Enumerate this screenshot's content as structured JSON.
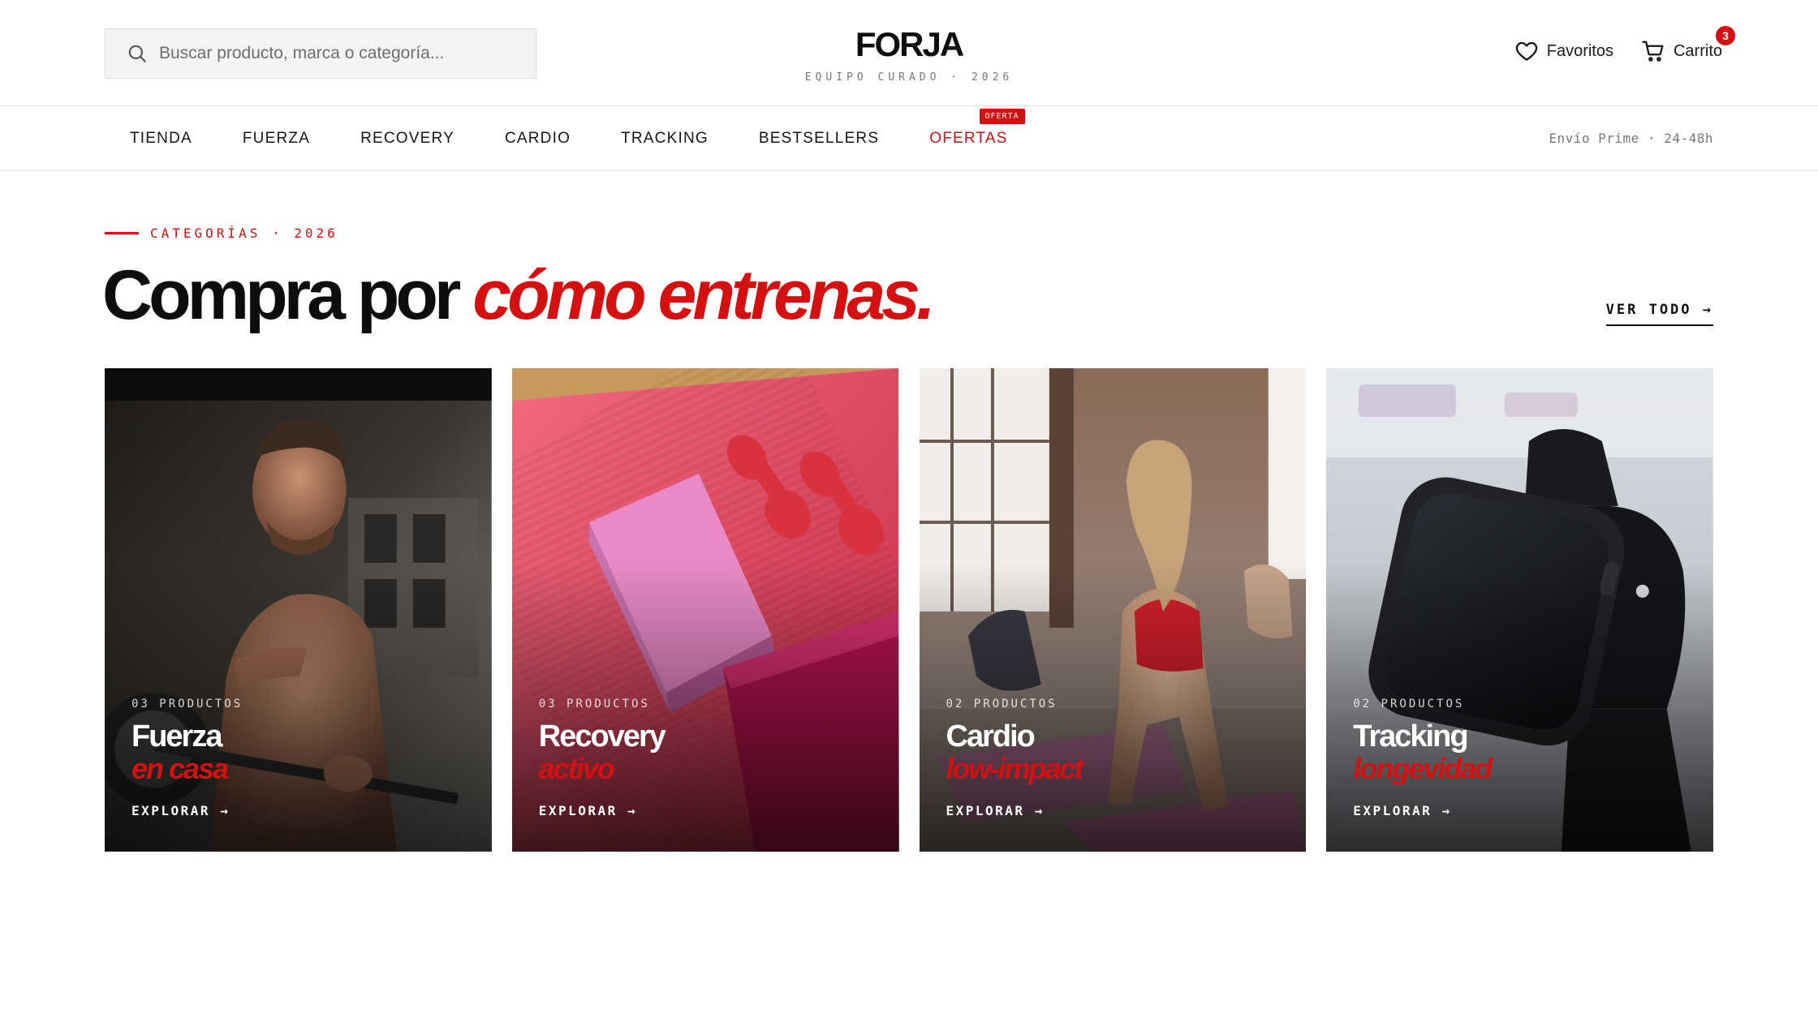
{
  "header": {
    "search_placeholder": "Buscar producto, marca o categoría...",
    "logo": "FORJA",
    "logo_sub": "EQUIPO CURADO · 2026",
    "favorites_label": "Favoritos",
    "cart_label": "Carrito",
    "cart_count": "3"
  },
  "nav": {
    "items": [
      {
        "label": "TIENDA"
      },
      {
        "label": "FUERZA"
      },
      {
        "label": "RECOVERY"
      },
      {
        "label": "CARDIO"
      },
      {
        "label": "TRACKING"
      },
      {
        "label": "BESTSELLERS"
      },
      {
        "label": "OFERTAS",
        "tag": "OFERTA"
      }
    ],
    "shipping": "Envío Prime · 24-48h"
  },
  "section": {
    "eyebrow": "CATEGORÍAS · 2026",
    "headline_main": "Compra por ",
    "headline_accent": "cómo entrenas.",
    "see_all": "VER TODO →"
  },
  "cards": [
    {
      "count": "03 PRODUCTOS",
      "title": "Fuerza",
      "subtitle": "en casa",
      "cta": "EXPLORAR →"
    },
    {
      "count": "03 PRODUCTOS",
      "title": "Recovery",
      "subtitle": "activo",
      "cta": "EXPLORAR →"
    },
    {
      "count": "02 PRODUCTOS",
      "title": "Cardio",
      "subtitle": "low-impact",
      "cta": "EXPLORAR →"
    },
    {
      "count": "02 PRODUCTOS",
      "title": "Tracking",
      "subtitle": "longevidad",
      "cta": "EXPLORAR →"
    }
  ],
  "colors": {
    "accent": "#d41010",
    "text": "#0d0d0d",
    "muted": "#777777"
  },
  "icons": [
    "search-icon",
    "heart-icon",
    "cart-icon",
    "arrow-right-icon"
  ]
}
